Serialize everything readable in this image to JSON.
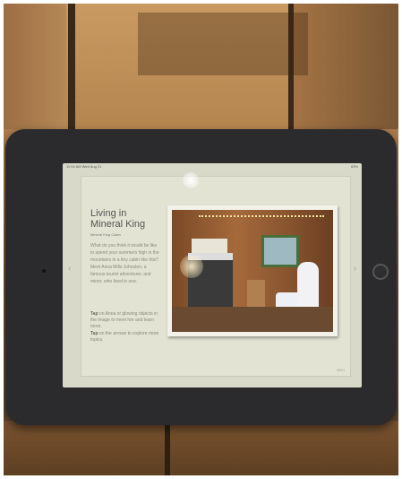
{
  "screen": {
    "status_left": "11:04 AM  Wed Aug 21",
    "status_right": "63%",
    "title_line1": "Living in",
    "title_line2": "Mineral King",
    "credit": "Mineral King Cabin",
    "body": "What do you think it would be like to spend your summers high in the mountains in a tiny cabin like this? Meet Anna Mills Johnston, a famous tourist adventurer, and miner, who lived in one.",
    "tip1_label": "Tap",
    "tip1_text": " on Anna or glowing objects in the image to meet her and learn more.",
    "tip2_label": "Tap",
    "tip2_text": " on the arrows to explore more topics.",
    "arrow_left": "‹",
    "arrow_right": "›",
    "corner_logo": "SEKI"
  },
  "colors": {
    "screen_bg": "#d8d9c9",
    "tablet_body": "#2b2b2d",
    "wood": "#b5854f"
  }
}
